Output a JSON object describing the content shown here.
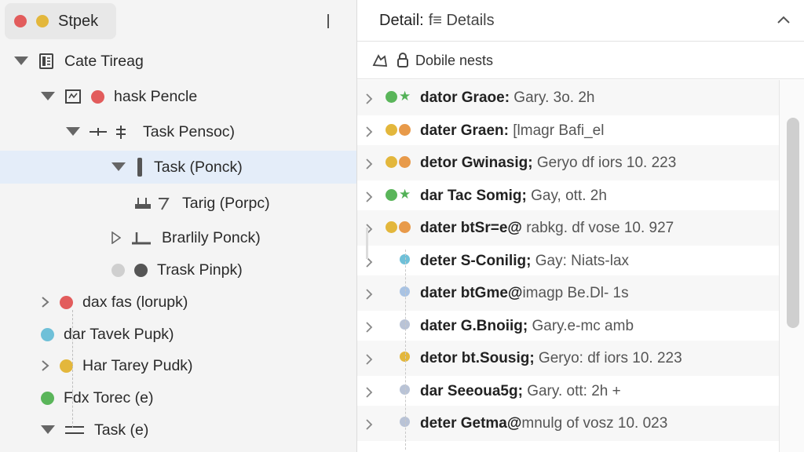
{
  "app": {
    "title": "Stpek",
    "dot_colors": [
      "#e25c5c",
      "#e3b73c"
    ]
  },
  "tree": [
    {
      "label": "Cate Tireag",
      "expander": "down",
      "icon": "document-icon",
      "depth": 0
    },
    {
      "label": "hask Pencle",
      "expander": "down",
      "icon": "board-icon",
      "dot": "#e25c5c",
      "depth": 1
    },
    {
      "label": "Task Pensoc)",
      "expander": "down",
      "icon": "split-icon",
      "depth": 2
    },
    {
      "label": "Task (Ponck)",
      "expander": "down",
      "icon": "bar-icon",
      "depth": 3,
      "selected": true
    },
    {
      "label": "Tarig (Porpc)",
      "icon": "connector-icon",
      "depth": 4
    },
    {
      "label": "Brarlily Ponck)",
      "expander": "right-open",
      "icon": "baseline-icon",
      "depth": 3
    },
    {
      "label": "Trask Pinpk)",
      "dots": [
        "#cfcfcf",
        "#555555"
      ],
      "depth": 3
    },
    {
      "label": "dax fas (lorupk)",
      "expander": "right",
      "dot": "#e25c5c",
      "depth": 1
    },
    {
      "label": "dar Tavek Pupk)",
      "dot": "#6fc0d8",
      "depth": 1
    },
    {
      "label": "Har Tarey Pudk)",
      "expander": "right",
      "dot": "#e3b73c",
      "depth": 1
    },
    {
      "label": "Fdx Torec (e)",
      "dot": "#5ab55a",
      "depth": 1
    },
    {
      "label": "Task (e)",
      "expander": "down",
      "icon": "lines-icon",
      "depth": 1
    }
  ],
  "detail": {
    "title": "Detail:",
    "subtitle": "f≡ Details",
    "toolbar_label": "Dobile nests"
  },
  "list": [
    {
      "bold": "dator Graoe:",
      "rest": " Gary. 3o. 2h",
      "marks": [
        "dot:#5ab55a",
        "star"
      ]
    },
    {
      "bold": "dater Graen:",
      "rest": " [lmagr Bafi_el",
      "marks": [
        "dot:#e3b73c",
        "dot:#e89a4a"
      ]
    },
    {
      "bold": "detor Gwinasig;",
      "rest": " Geryo df iors 10. 223",
      "marks": [
        "dot:#e3b73c",
        "dot:#e89a4a"
      ]
    },
    {
      "bold": "dar Tac Somig;",
      "rest": " Gay, ott. 2h",
      "marks": [
        "dot:#5ab55a",
        "star"
      ]
    },
    {
      "bold": "dater btSr=e@",
      "rest": " rabkg. df vose 10. 927",
      "marks": [
        "dot:#e3b73c",
        "dot:#e89a4a"
      ]
    },
    {
      "bold": "deter S-Conilig;",
      "rest": " Gay: Niats-lax",
      "marks": [
        "small:#6fc0d8"
      ]
    },
    {
      "bold": "dater btGme@",
      "rest": "imagp Be.Dl- 1s",
      "marks": [
        "small:#a9c3e3"
      ]
    },
    {
      "bold": "dater G.Bnoiig;",
      "rest": " Gary.e-mc amb",
      "marks": [
        "small:#b9c3d6"
      ]
    },
    {
      "bold": "detor bt.Sousig;",
      "rest": " Geryo: df iors 10. 223",
      "marks": [
        "small:#e3b73c"
      ]
    },
    {
      "bold": "dar Seeoua5g;",
      "rest": " Gary. ott: 2h +",
      "marks": [
        "small:#b9c3d6"
      ]
    },
    {
      "bold": "deter Getma@",
      "rest": "mnulg of vosz 10. 023",
      "marks": [
        "small:#b9c3d6"
      ]
    }
  ]
}
